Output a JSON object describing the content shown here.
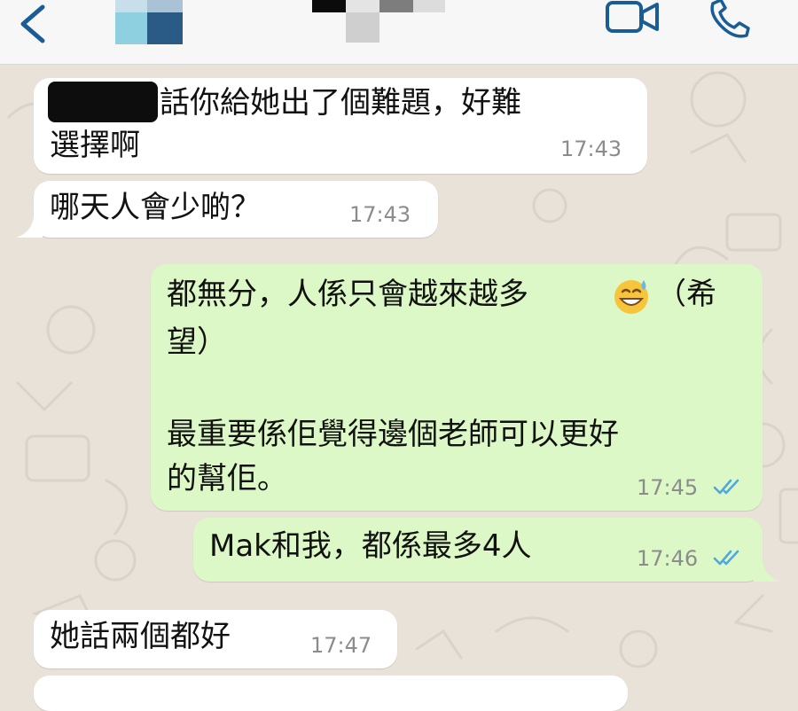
{
  "header": {
    "back_icon": "chevron-left-icon",
    "video_icon": "video-call-icon",
    "call_icon": "phone-icon",
    "accent_color": "#1a5d96"
  },
  "messages": [
    {
      "direction": "incoming",
      "line1": "話你給她出了個難題，好難",
      "line2": "選擇啊",
      "time": "17:43"
    },
    {
      "direction": "incoming",
      "line1": "哪天人會少啲？",
      "time": "17:43"
    },
    {
      "direction": "outgoing",
      "line1": "都無分，人係只會越來越多",
      "line1b": "（希",
      "line2": "望）",
      "line3": "最重要係佢覺得邊個老師可以更好",
      "line4": "的幫佢。",
      "emoji": "sweat-smile-emoji",
      "time": "17:45",
      "status": "read"
    },
    {
      "direction": "outgoing",
      "line1": "Mak和我，都係最多4人",
      "time": "17:46",
      "status": "read"
    },
    {
      "direction": "incoming",
      "line1": "她話兩個都好",
      "time": "17:47"
    }
  ],
  "colors": {
    "incoming_bubble": "#ffffff",
    "outgoing_bubble": "#dcf8c6",
    "read_ticks": "#4fa8e0",
    "wallpaper": "#e8e2d9"
  }
}
